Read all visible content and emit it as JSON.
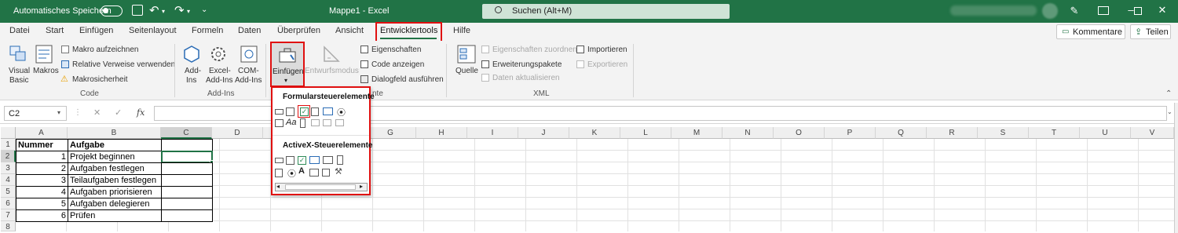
{
  "titlebar": {
    "autosave_label": "Automatisches Speichern",
    "doc_title": "Mappe1  -  Excel",
    "search_placeholder": "Suchen (Alt+M)",
    "bg_color": "#217346"
  },
  "tabs": [
    "Datei",
    "Start",
    "Einfügen",
    "Seitenlayout",
    "Formeln",
    "Daten",
    "Überprüfen",
    "Ansicht",
    "Entwicklertools",
    "Hilfe"
  ],
  "active_tab": "Entwicklertools",
  "actions": {
    "comments": "Kommentare",
    "share": "Teilen"
  },
  "ribbon": {
    "code": {
      "group_label": "Code",
      "visual_basic_1": "Visual",
      "visual_basic_2": "Basic",
      "macros": "Makros",
      "record_macro": "Makro aufzeichnen",
      "relative_refs": "Relative Verweise verwenden",
      "macro_security": "Makrosicherheit"
    },
    "addins": {
      "group_label": "Add-Ins",
      "addins_1": "Add-",
      "addins_2": "Ins",
      "excel_addins_1": "Excel-",
      "excel_addins_2": "Add-Ins",
      "com_addins_1": "COM-",
      "com_addins_2": "Add-Ins"
    },
    "controls": {
      "group_label_tail": "nte",
      "insert": "Einfügen",
      "design_mode": "Entwurfsmodus",
      "properties": "Eigenschaften",
      "view_code": "Code anzeigen",
      "run_dialog": "Dialogfeld ausführen"
    },
    "xml": {
      "group_label": "XML",
      "source": "Quelle",
      "map_properties": "Eigenschaften zuordnen",
      "expansion_packs": "Erweiterungspakete",
      "refresh_data": "Daten aktualisieren",
      "import": "Importieren",
      "export": "Exportieren"
    }
  },
  "dropdown": {
    "form_controls_header": "Formularsteuerelemente",
    "activex_header": "ActiveX-Steuerelemente"
  },
  "formula_bar": {
    "name_box": "C2",
    "fx": "fx",
    "cancel": "✕",
    "enter": "✓"
  },
  "columns": [
    "A",
    "B",
    "C",
    "D",
    "E",
    "F",
    "G",
    "H",
    "I",
    "J",
    "K",
    "L",
    "M",
    "N",
    "O",
    "P",
    "Q",
    "R",
    "S",
    "T",
    "U",
    "V"
  ],
  "rows": [
    "1",
    "2",
    "3",
    "4",
    "5",
    "6",
    "7",
    "8"
  ],
  "sheet": {
    "headers": {
      "a": "Nummer",
      "b": "Aufgabe"
    },
    "data": [
      {
        "num": "1",
        "task": "Projekt beginnen"
      },
      {
        "num": "2",
        "task": "Aufgaben festlegen"
      },
      {
        "num": "3",
        "task": "Teilaufgaben festlegen"
      },
      {
        "num": "4",
        "task": "Aufgaben priorisieren"
      },
      {
        "num": "5",
        "task": "Aufgaben delegieren"
      },
      {
        "num": "6",
        "task": "Prüfen"
      }
    ]
  },
  "colors": {
    "highlight": "#e01010",
    "excel_green": "#217346",
    "selection": "#217346"
  }
}
